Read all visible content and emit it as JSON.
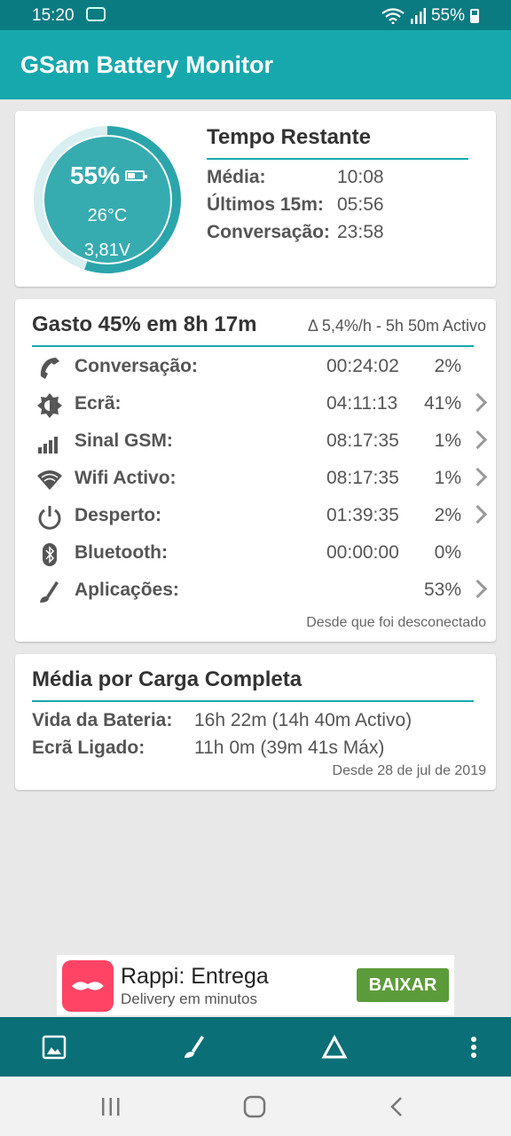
{
  "status_bar": {
    "time": "15:20",
    "battery_pct": "55%"
  },
  "app": {
    "title": "GSam Battery Monitor"
  },
  "gauge": {
    "percent": "55%",
    "temperature": "26°C",
    "voltage": "3,81V",
    "level": 0.55
  },
  "tempo_restante": {
    "title": "Tempo Restante",
    "rows": [
      {
        "label": "Média:",
        "value": "10:08"
      },
      {
        "label": "Últimos 15m:",
        "value": "05:56"
      },
      {
        "label": "Conversação:",
        "value": "23:58"
      }
    ]
  },
  "gasto": {
    "title": "Gasto 45% em 8h 17m",
    "rate": "Δ 5,4%/h - 5h 50m Activo",
    "rows": [
      {
        "label": "Conversação:",
        "duration": "00:24:02",
        "percent": "2%",
        "icon": "phone-icon"
      },
      {
        "label": "Ecrã:",
        "duration": "04:11:13",
        "percent": "41%",
        "icon": "brightness-icon"
      },
      {
        "label": "Sinal GSM:",
        "duration": "08:17:35",
        "percent": "1%",
        "icon": "signal-icon"
      },
      {
        "label": "Wifi Activo:",
        "duration": "08:17:35",
        "percent": "1%",
        "icon": "wifi-icon"
      },
      {
        "label": "Desperto:",
        "duration": "01:39:35",
        "percent": "2%",
        "icon": "power-icon"
      },
      {
        "label": "Bluetooth:",
        "duration": "00:00:00",
        "percent": "0%",
        "icon": "bluetooth-icon"
      },
      {
        "label": "Aplicações:",
        "duration": "",
        "percent": "53%",
        "icon": "apps-icon"
      }
    ],
    "since": "Desde que foi desconectado"
  },
  "media": {
    "title": "Média por Carga Completa",
    "rows": [
      {
        "label": "Vida da Bateria:",
        "value": "16h 22m (14h 40m Activo)"
      },
      {
        "label": "Ecrã Ligado:",
        "value": "11h 0m (39m 41s Máx)"
      }
    ],
    "since": "Desde 28 de jul de 2019"
  },
  "ad": {
    "title": "Rappi: Entrega",
    "subtitle": "Delivery em minutos",
    "button": "BAIXAR"
  }
}
